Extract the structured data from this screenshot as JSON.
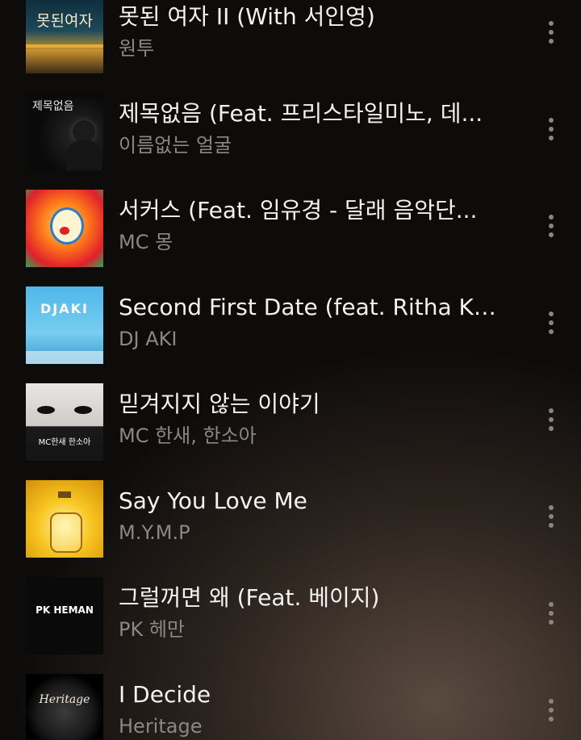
{
  "tracks": [
    {
      "title": "못된 여자 II (With 서인영)",
      "artist": "원투",
      "art_label": "못된여자",
      "art_icon": "album-art-sunset"
    },
    {
      "title": "제목없음 (Feat. 프리스타일미노, 데...",
      "artist": "이름없는 얼굴",
      "art_label": "제목없음",
      "art_icon": "album-art-silhouette"
    },
    {
      "title": "서커스 (Feat. 임유경 - 달래 음악단...",
      "artist": "MC 몽",
      "art_label": "",
      "art_icon": "album-art-clown"
    },
    {
      "title": "Second First Date (feat. Ritha K)...",
      "artist": "DJ AKI",
      "art_label": "DJAKI",
      "art_icon": "album-art-sky"
    },
    {
      "title": "믿겨지지 않는 이야기",
      "artist": "MC 한새, 한소아",
      "art_label": "MC한새 한소아",
      "art_icon": "album-art-eyes"
    },
    {
      "title": "Say You Love Me",
      "artist": "M.Y.M.P",
      "art_label": "",
      "art_icon": "album-art-bottle"
    },
    {
      "title": "그럴꺼면 왜 (Feat. 베이지)",
      "artist": "PK 헤만",
      "art_label": "PK HEMAN",
      "art_icon": "album-art-text"
    },
    {
      "title": "I Decide",
      "artist": "Heritage",
      "art_label": "Heritage",
      "art_icon": "album-art-vinyl"
    }
  ],
  "more_icon": "more-vertical-icon"
}
